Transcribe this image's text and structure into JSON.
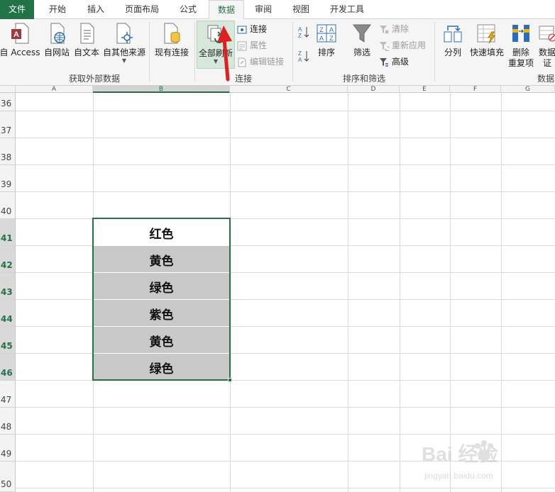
{
  "tabs": [
    "文件",
    "开始",
    "插入",
    "页面布局",
    "公式",
    "数据",
    "审阅",
    "视图",
    "开发工具"
  ],
  "active_tab": "数据",
  "ribbon": {
    "external_data": {
      "buttons": [
        "自 Access",
        "自网站",
        "自文本",
        "自其他来源"
      ],
      "group_label": "获取外部数据"
    },
    "existing_connections": "现有连接",
    "connections": {
      "refresh_all": "全部刷新",
      "connections": "连接",
      "properties": "属性",
      "edit_links": "编辑链接",
      "group_label": "连接"
    },
    "sort_filter": {
      "sort": "排序",
      "filter": "筛选",
      "clear": "清除",
      "reapply": "重新应用",
      "advanced": "高级",
      "group_label": "排序和筛选"
    },
    "data_tools": {
      "text_to_columns": "分列",
      "flash_fill": "快速填充",
      "remove_duplicates_line1": "删除",
      "remove_duplicates_line2": "重复项",
      "validation_line1": "数据",
      "validation_line2": "证",
      "group_label": "数据"
    }
  },
  "sheet": {
    "columns": [
      "A",
      "B",
      "C",
      "D",
      "E",
      "F",
      "G"
    ],
    "selected_column": "B",
    "rows": [
      "36",
      "37",
      "38",
      "39",
      "40",
      "41",
      "42",
      "43",
      "44",
      "45",
      "46",
      "47",
      "48",
      "49",
      "50"
    ],
    "selected_rows": [
      "41",
      "42",
      "43",
      "44",
      "45",
      "46"
    ],
    "cells_b": [
      {
        "row": "41",
        "value": "红色",
        "shaded": false
      },
      {
        "row": "42",
        "value": "黄色",
        "shaded": true
      },
      {
        "row": "43",
        "value": "绿色",
        "shaded": true
      },
      {
        "row": "44",
        "value": "紫色",
        "shaded": true
      },
      {
        "row": "45",
        "value": "黄色",
        "shaded": true
      },
      {
        "row": "46",
        "value": "绿色",
        "shaded": true
      }
    ]
  },
  "watermark": {
    "brand": "Bai 经验",
    "url": "jingyan.baidu.com"
  },
  "colors": {
    "excel_green": "#217346",
    "shaded_fill": "#c8c8c8",
    "arrow_red": "#e02020"
  }
}
